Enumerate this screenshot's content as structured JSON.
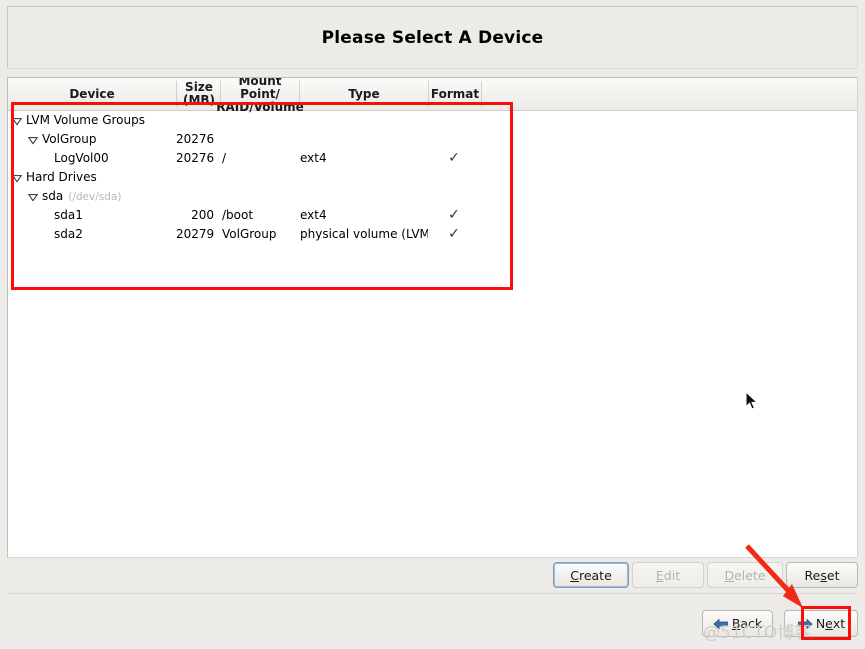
{
  "window": {
    "title": "Please Select A Device"
  },
  "table": {
    "headers": [
      {
        "name": "device",
        "line1": "Device",
        "line2": ""
      },
      {
        "name": "size",
        "line1": "Size",
        "line2": "(MB)"
      },
      {
        "name": "mount-point",
        "line1": "Mount Point/",
        "line2": "RAID/Volume"
      },
      {
        "name": "type",
        "line1": "Type",
        "line2": ""
      },
      {
        "name": "format",
        "line1": "Format",
        "line2": ""
      }
    ],
    "rows": [
      {
        "device": "LVM Volume Groups",
        "devpath": "",
        "size": "",
        "mount": "",
        "type": "",
        "format": "",
        "indent": 1,
        "expander": "expanded"
      },
      {
        "device": "VolGroup",
        "devpath": "",
        "size": "20276",
        "mount": "",
        "type": "",
        "format": "",
        "indent": 2,
        "expander": "expanded"
      },
      {
        "device": "LogVol00",
        "devpath": "",
        "size": "20276",
        "mount": "/",
        "type": "ext4",
        "format": "✓",
        "indent": 3,
        "expander": "none"
      },
      {
        "device": "Hard Drives",
        "devpath": "",
        "size": "",
        "mount": "",
        "type": "",
        "format": "",
        "indent": 1,
        "expander": "expanded"
      },
      {
        "device": "sda",
        "devpath": "(/dev/sda)",
        "size": "",
        "mount": "",
        "type": "",
        "format": "",
        "indent": 2,
        "expander": "expanded"
      },
      {
        "device": "sda1",
        "devpath": "",
        "size": "200",
        "mount": "/boot",
        "type": "ext4",
        "format": "✓",
        "indent": 3,
        "expander": "none"
      },
      {
        "device": "sda2",
        "devpath": "",
        "size": "20279",
        "mount": "VolGroup",
        "type": "physical volume (LVM)",
        "format": "✓",
        "indent": 3,
        "expander": "none"
      }
    ]
  },
  "actions": {
    "create": {
      "prefix": "C",
      "rest": "reate",
      "state": "focused"
    },
    "edit": {
      "prefix": "E",
      "rest": "dit",
      "state": "disabled"
    },
    "delete": {
      "prefix": "D",
      "rest": "elete",
      "state": "disabled"
    },
    "reset": {
      "pre": "Re",
      "prefix": "s",
      "rest": "et",
      "state": "enabled"
    }
  },
  "navigation": {
    "back": {
      "prefix": "B",
      "rest": "ack"
    },
    "next": {
      "pre": "N",
      "prefix": "e",
      "rest": "xt"
    }
  },
  "annotations": {
    "watermark": "@51CTO博客",
    "highlight_color": "#fb0d0d",
    "arrow_color": "#f12a14"
  }
}
